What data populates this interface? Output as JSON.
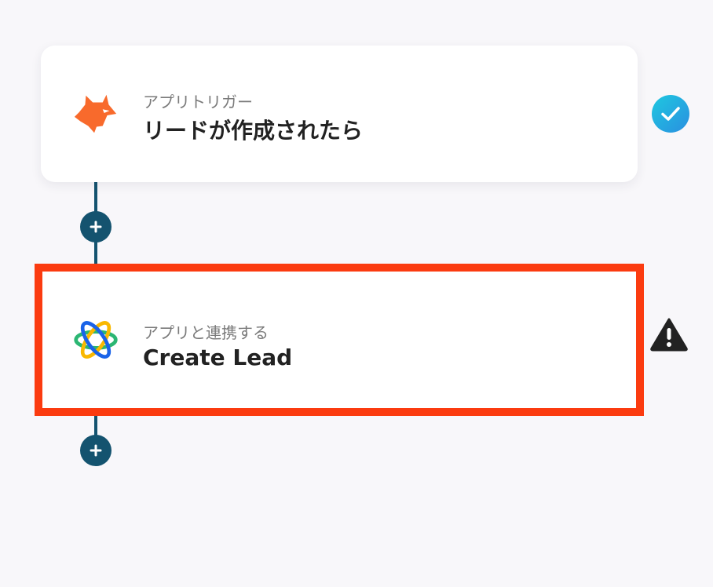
{
  "flow": {
    "steps": [
      {
        "subtitle": "アプリトリガー",
        "title": "リードが作成されたら",
        "app_icon": "fox-icon",
        "status": "complete",
        "status_icon": "check-circle-icon"
      },
      {
        "subtitle": "アプリと連携する",
        "title": "Create Lead",
        "app_icon": "orbit-logo-icon",
        "status": "warning",
        "status_icon": "warning-triangle-icon"
      }
    ],
    "add_step_icon": "plus-icon"
  },
  "colors": {
    "background": "#f8f7fa",
    "connector": "#14536f",
    "highlight_border": "#fb3b10",
    "check_gradient_start": "#1ec8e0",
    "check_gradient_end": "#2a8fe0",
    "fox": "#f86a2c",
    "warning": "#222222"
  }
}
